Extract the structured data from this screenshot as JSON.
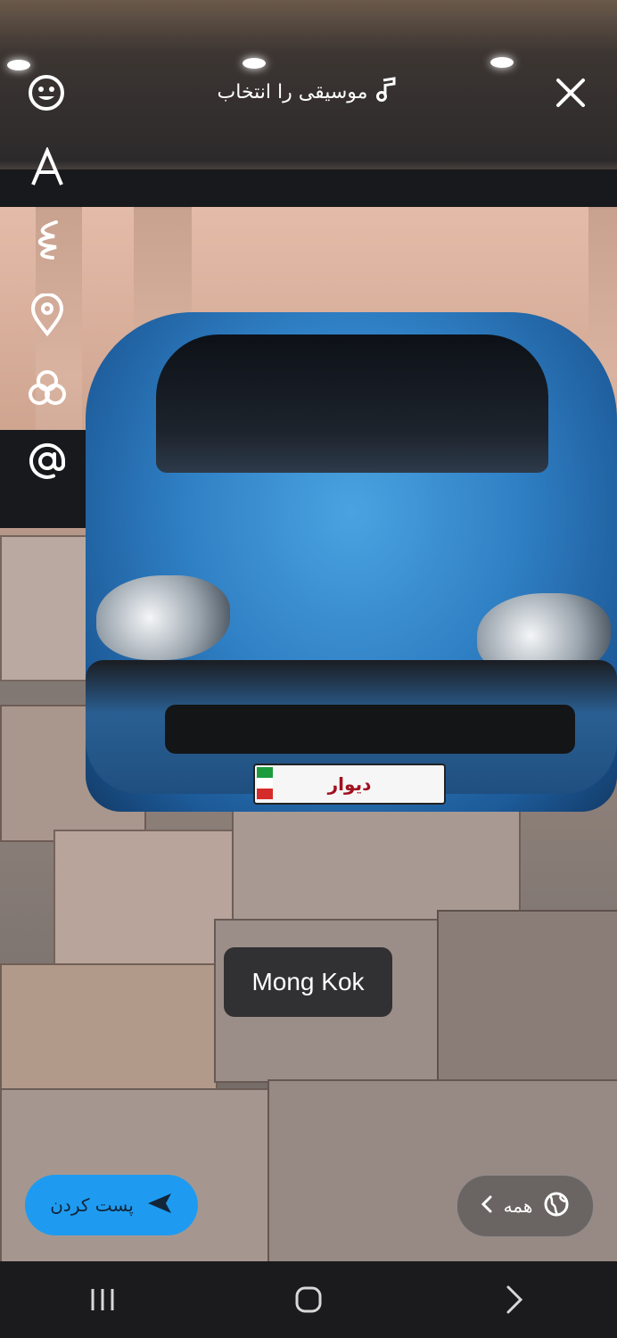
{
  "topbar": {
    "music_label": "موسیقی را انتخاب",
    "close_icon": "close-icon",
    "sticker_icon": "smiley-icon",
    "music_icon": "music-note-icon"
  },
  "side_tools": [
    {
      "name": "text-tool",
      "icon": "text-A-icon"
    },
    {
      "name": "draw-tool",
      "icon": "scribble-icon"
    },
    {
      "name": "location-tool",
      "icon": "location-pin-icon"
    },
    {
      "name": "filter-tool",
      "icon": "circles-icon"
    },
    {
      "name": "mention-tool",
      "icon": "at-sign-icon"
    }
  ],
  "photo": {
    "plate_text": "دیوار"
  },
  "location_sticker": "Mong Kok",
  "bottom": {
    "post_label": "پست کردن",
    "audience_label": "همه"
  },
  "navbar": {
    "recent_icon": "recent-apps-icon",
    "home_icon": "home-icon",
    "back_icon": "back-chevron-icon"
  },
  "colors": {
    "post_button": "#1e9bf0",
    "overlay": "#28282a"
  }
}
